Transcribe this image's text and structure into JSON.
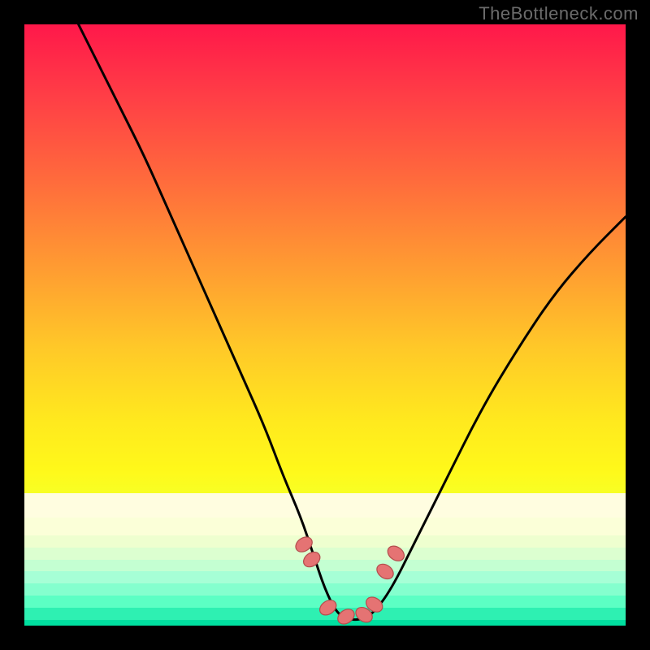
{
  "watermark": "TheBottleneck.com",
  "chart_data": {
    "type": "line",
    "title": "",
    "xlabel": "",
    "ylabel": "",
    "xlim": [
      0,
      100
    ],
    "ylim": [
      0,
      100
    ],
    "curve": {
      "name": "bottleneck-curve",
      "x": [
        9,
        12,
        16,
        20,
        24,
        28,
        32,
        36,
        40,
        43,
        46,
        48,
        50,
        52,
        54,
        56,
        58,
        61,
        65,
        70,
        76,
        82,
        88,
        94,
        100
      ],
      "y": [
        100,
        94,
        86,
        78,
        69,
        60,
        51,
        42,
        33,
        25,
        18,
        12,
        6,
        2,
        1,
        1,
        2,
        6,
        14,
        24,
        36,
        46,
        55,
        62,
        68
      ]
    },
    "markers": {
      "name": "highlight-points",
      "x": [
        46.5,
        47.8,
        50.5,
        53.5,
        56.5,
        58.2,
        60.0,
        61.8
      ],
      "y": [
        13.5,
        11.0,
        3.0,
        1.5,
        1.8,
        3.5,
        9.0,
        12.0
      ]
    },
    "background_bands": [
      {
        "color": "#fffde0",
        "from": 78,
        "to": 82
      },
      {
        "color": "#fbffd8",
        "from": 82,
        "to": 85
      },
      {
        "color": "#eeffcf",
        "from": 85,
        "to": 87
      },
      {
        "color": "#dcffd0",
        "from": 87,
        "to": 89
      },
      {
        "color": "#c4ffd2",
        "from": 89,
        "to": 91
      },
      {
        "color": "#a6ffd6",
        "from": 91,
        "to": 93
      },
      {
        "color": "#84ffce",
        "from": 93,
        "to": 95
      },
      {
        "color": "#5cffc4",
        "from": 95,
        "to": 97
      },
      {
        "color": "#2ef0b2",
        "from": 97,
        "to": 99
      },
      {
        "color": "#00e0a0",
        "from": 99,
        "to": 100
      }
    ]
  }
}
